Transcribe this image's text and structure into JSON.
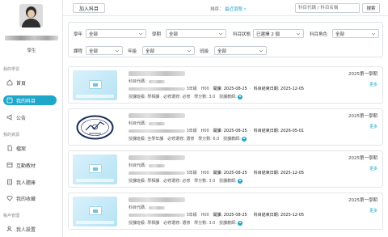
{
  "sidebar": {
    "role": "學生",
    "sections": [
      {
        "title": "我的學習",
        "items": [
          {
            "label": "首頁",
            "icon": "home-icon",
            "active": false
          },
          {
            "label": "我的科目",
            "icon": "book-icon",
            "active": true
          },
          {
            "label": "公告",
            "icon": "megaphone-icon",
            "active": false
          }
        ]
      },
      {
        "title": "我的資源",
        "items": [
          {
            "label": "檔案",
            "icon": "file-icon",
            "active": false
          },
          {
            "label": "互動教材",
            "icon": "layers-icon",
            "active": false
          },
          {
            "label": "我人題庫",
            "icon": "question-bank-icon",
            "active": false
          },
          {
            "label": "我的收藏",
            "icon": "heart-icon",
            "active": false
          }
        ]
      },
      {
        "title": "帳戶管理",
        "items": [
          {
            "label": "我人設置",
            "icon": "user-settings-icon",
            "active": false
          }
        ]
      }
    ],
    "accent": "#1fa7c9"
  },
  "topbar": {
    "add_label": "加入科目",
    "sort_label": "排序：",
    "sort_value": "最近瀏覽 ▿",
    "search_placeholder": "科目代碼 / 科目名稱",
    "search_label": "搜索"
  },
  "filters": {
    "row1": [
      {
        "label": "學年",
        "value": "全部"
      },
      {
        "label": "學期",
        "value": "全部"
      },
      {
        "label": "科目狀態",
        "value": "已選擇 2 個"
      },
      {
        "label": "科目角色",
        "value": "全部"
      }
    ],
    "row2": [
      {
        "label": "課程",
        "value": "全部"
      },
      {
        "label": "年級",
        "value": "全部"
      },
      {
        "label": "班級",
        "value": "全部"
      }
    ]
  },
  "courses": [
    {
      "thumb": "tile",
      "semester": "2025第一學期",
      "more": "更多",
      "code_label": "科目代碼：",
      "credit_hours": "3年級",
      "h": "H00",
      "start": "開課: 2025-08-25",
      "end": "科目結束日期: 2025-12-05",
      "teacher_label": "授課班級: 學相課",
      "type": "必修選修: 必修",
      "credit": "學分數: 3.0",
      "teacher_role": "授課教師:"
    },
    {
      "thumb": "logo",
      "semester": "2025第一學期",
      "more": "更多",
      "code_label": "科目代碼：",
      "credit_hours": "3年級",
      "h": "H00",
      "start": "開課: 2025-08-25",
      "end": "科目結束日期: 2026-05-01",
      "teacher_label": "授課班級: 全學年課",
      "type": "必修選修: 選修",
      "credit": "學分數: 6.0",
      "teacher_role": "授課教師:"
    },
    {
      "thumb": "tile",
      "semester": "2025第一學期",
      "more": "更多",
      "code_label": "科目代碼：",
      "credit_hours": "3年級",
      "h": "H00",
      "start": "開課: 2025-08-25",
      "end": "科目結束日期: 2025-12-05",
      "teacher_label": "授課班級: 學相課",
      "type": "必修選修: 必修",
      "credit": "學分數: 3.0",
      "teacher_role": "授課教師:"
    },
    {
      "thumb": "tile",
      "semester": "2025第一學期",
      "more": "更多",
      "code_label": "科目代碼：",
      "credit_hours": "3年級",
      "h": "H00",
      "start": "開課: 2025-08-25",
      "end": "科目結束日期: 2025-12-05",
      "teacher_label": "授課班級: 學相課",
      "type": "必修選修: 選修",
      "credit": "學分數: 3.0",
      "teacher_role": "授課教師:"
    }
  ]
}
